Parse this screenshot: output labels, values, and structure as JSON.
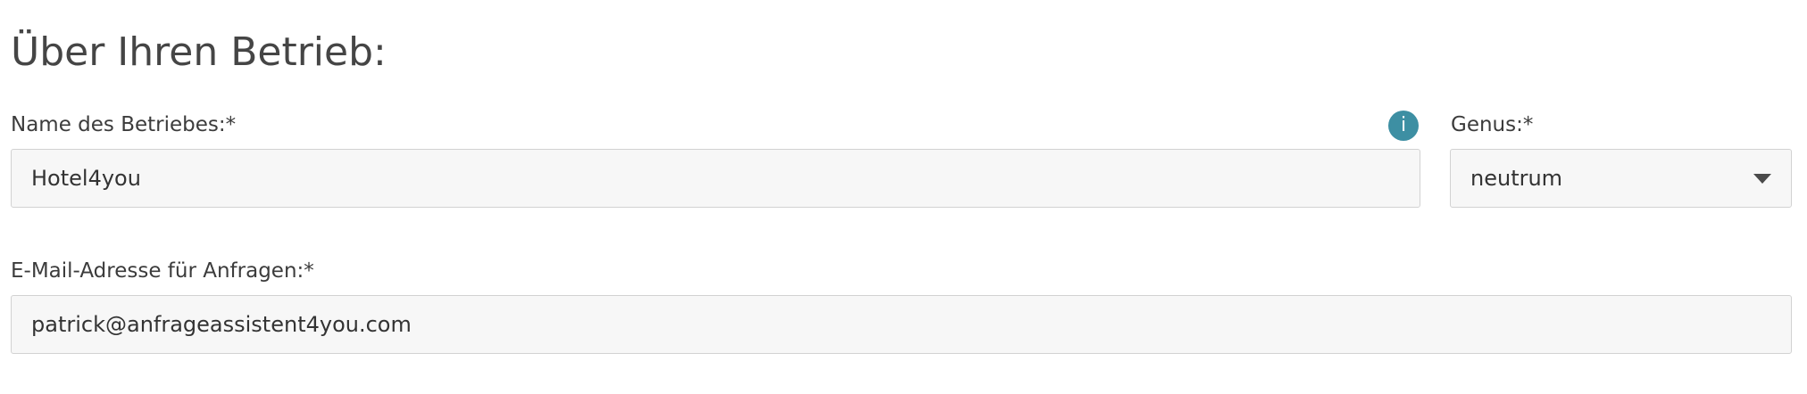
{
  "section": {
    "title": "Über Ihren Betrieb:"
  },
  "business_name": {
    "label": "Name des Betriebes:*",
    "value": "Hotel4you",
    "info_icon_glyph": "i",
    "info_icon_color": "#3d8fa3"
  },
  "genus": {
    "label": "Genus:*",
    "selected": "neutrum"
  },
  "email": {
    "label": "E-Mail-Adresse für Anfragen:*",
    "value": "patrick@anfrageassistent4you.com"
  }
}
